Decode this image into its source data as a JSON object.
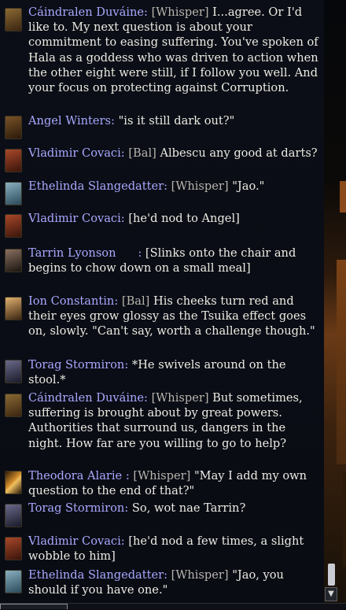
{
  "messages": [
    {
      "speaker": "Cáindralen Duváine:",
      "tag": "[Whisper]",
      "text": "I...agree. Or I'd like to. My next question is about your commitment to easing suffering. You've spoken of Hala as a goddess who was driven to action when the other eight were still, if I follow you well. And your focus on protecting against Corruption.",
      "avatar": "#6b4a24"
    },
    {
      "speaker": "Angel Winters:",
      "tag": "",
      "text": "\"is it still dark out?\"",
      "avatar": "#5a3a1c"
    },
    {
      "speaker": "Vladimir Covaci:",
      "tag": "[Bal]",
      "text": "Albescu any good at darts?",
      "avatar": "#7a2a1a"
    },
    {
      "speaker": "Ethelinda Slangedatter:",
      "tag": "[Whisper]",
      "text": "\"Jao.\"",
      "avatar": "#4a6a7a"
    },
    {
      "speaker": "Vladimir Covaci:",
      "tag": "",
      "text": "[he'd nod to Angel]",
      "avatar": "#7a2a1a"
    },
    {
      "speaker": "Tarrin Lyonson      :",
      "tag": "",
      "text": "[Slinks onto the chair and begins to chow down on a small meal]",
      "avatar": "#4a3a30"
    },
    {
      "speaker": "Ion Constantin:",
      "tag": "[Bal]",
      "text": "His cheeks turn red and their eyes grow glossy as the Tsuika effect goes on, slowly. \"Can't say, worth a challenge though.\"",
      "avatar": "#8a6a3a"
    },
    {
      "speaker": "Torag Stormiron:",
      "tag": "",
      "text": "*He swivels around on the stool.*",
      "avatar": "#4a4a6a"
    },
    {
      "speaker": "Cáindralen Duváine:",
      "tag": "[Whisper]",
      "text": "But sometimes, suffering is brought about by great powers. Authorities that surround us, dangers in the night. How far are you willing to go to help?",
      "avatar": "#6b4a24"
    },
    {
      "speaker": "Theodora Alarie :",
      "tag": "[Whisper]",
      "text": "\"May I add my own question to the end of that?\"",
      "avatar": "#a86a1a"
    },
    {
      "speaker": "Torag Stormiron:",
      "tag": "",
      "text": "So, wot nae Tarrin?",
      "avatar": "#4a4a6a"
    },
    {
      "speaker": "Vladimir Covaci:",
      "tag": "",
      "text": "[he'd nod a few times, a slight wobble to him]",
      "avatar": "#7a2a1a"
    },
    {
      "speaker": "Ethelinda Slangedatter:",
      "tag": "[Whisper]",
      "text": "\"Jao, you should if you have one.\"",
      "avatar": "#4a6a7a"
    }
  ],
  "colors": {
    "speaker": "#a8a8ff",
    "text": "#ecebe3",
    "tag": "#b8b5ad"
  },
  "icons": {
    "scroll_down": "▼"
  }
}
